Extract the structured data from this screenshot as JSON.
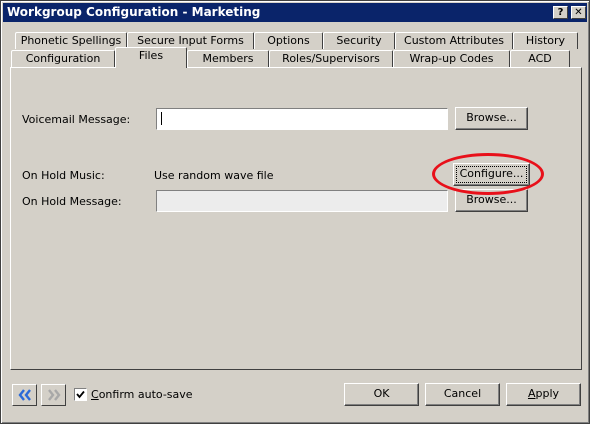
{
  "window": {
    "title": "Workgroup Configuration - Marketing",
    "help_label": "?",
    "close_label": "✕"
  },
  "tabs": {
    "top_row": [
      {
        "label": "Phonetic Spellings"
      },
      {
        "label": "Secure Input Forms"
      },
      {
        "label": "Options"
      },
      {
        "label": "Security"
      },
      {
        "label": "Custom Attributes"
      },
      {
        "label": "History"
      }
    ],
    "bottom_row": [
      {
        "label": "Configuration"
      },
      {
        "label": "Files"
      },
      {
        "label": "Members"
      },
      {
        "label": "Roles/Supervisors"
      },
      {
        "label": "Wrap-up Codes"
      },
      {
        "label": "ACD"
      }
    ],
    "active": "Files"
  },
  "files_panel": {
    "voicemail": {
      "label": "Voicemail Message:",
      "value": "",
      "browse_label": "Browse..."
    },
    "hold_music": {
      "label": "On Hold Music:",
      "value": "Use random wave file",
      "configure_label": "Configure..."
    },
    "hold_message": {
      "label": "On Hold Message:",
      "value": "",
      "browse_label": "Browse..."
    }
  },
  "footer": {
    "prev_icon": "double-chevron-left-icon",
    "next_icon": "double-chevron-right-icon",
    "confirm_autosave": {
      "checked": true,
      "label_first": "C",
      "label_rest": "onfirm auto-save"
    },
    "ok_label": "OK",
    "cancel_label": "Cancel",
    "apply_label_first": "A",
    "apply_label_rest": "pply"
  },
  "colors": {
    "titlebar": "#0a246a",
    "highlight_ring": "#e8101a",
    "nav_arrow_active": "#2a6ad8",
    "nav_arrow_disabled": "#a8a8a8"
  }
}
